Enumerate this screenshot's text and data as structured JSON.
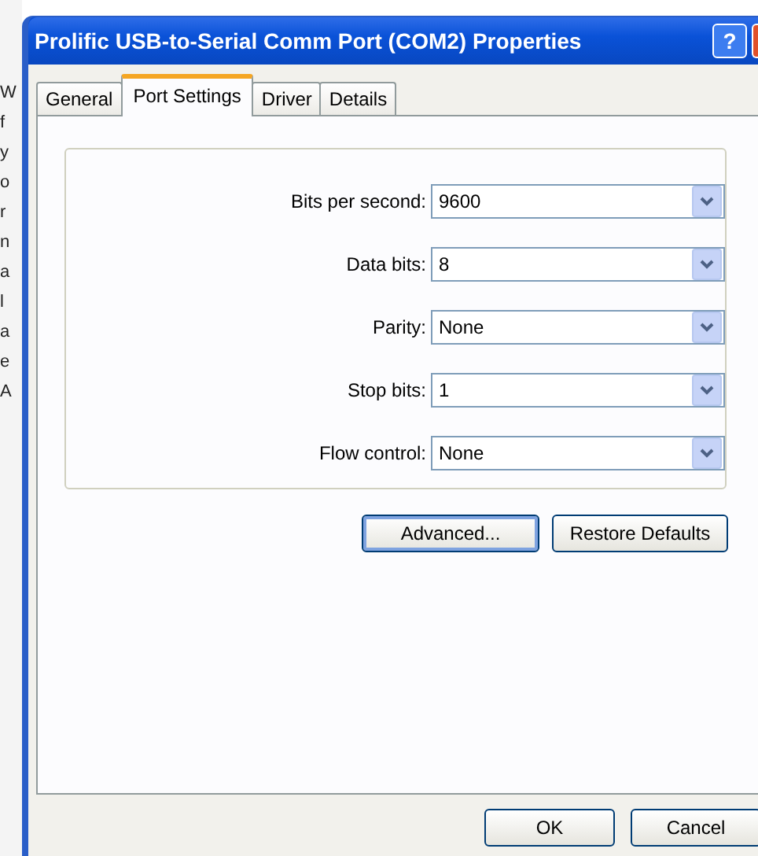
{
  "background_window": {
    "fragments": [
      "W",
      "f",
      "y",
      "o",
      "r",
      "n",
      "a",
      "l",
      "a",
      "e",
      "A"
    ]
  },
  "window": {
    "title": "Prolific USB-to-Serial Comm Port (COM2) Properties",
    "help": "?"
  },
  "tabs": [
    {
      "label": "General",
      "selected": false
    },
    {
      "label": "Port Settings",
      "selected": true
    },
    {
      "label": "Driver",
      "selected": false
    },
    {
      "label": "Details",
      "selected": false
    }
  ],
  "settings": [
    {
      "label": "Bits per second:",
      "value": "9600"
    },
    {
      "label": "Data bits:",
      "value": "8"
    },
    {
      "label": "Parity:",
      "value": "None"
    },
    {
      "label": "Stop bits:",
      "value": "1"
    },
    {
      "label": "Flow control:",
      "value": "None"
    }
  ],
  "panel_buttons": [
    {
      "label": "Advanced...",
      "default": true
    },
    {
      "label": "Restore Defaults",
      "default": false
    }
  ],
  "dialog_buttons": [
    "OK",
    "Cancel"
  ]
}
